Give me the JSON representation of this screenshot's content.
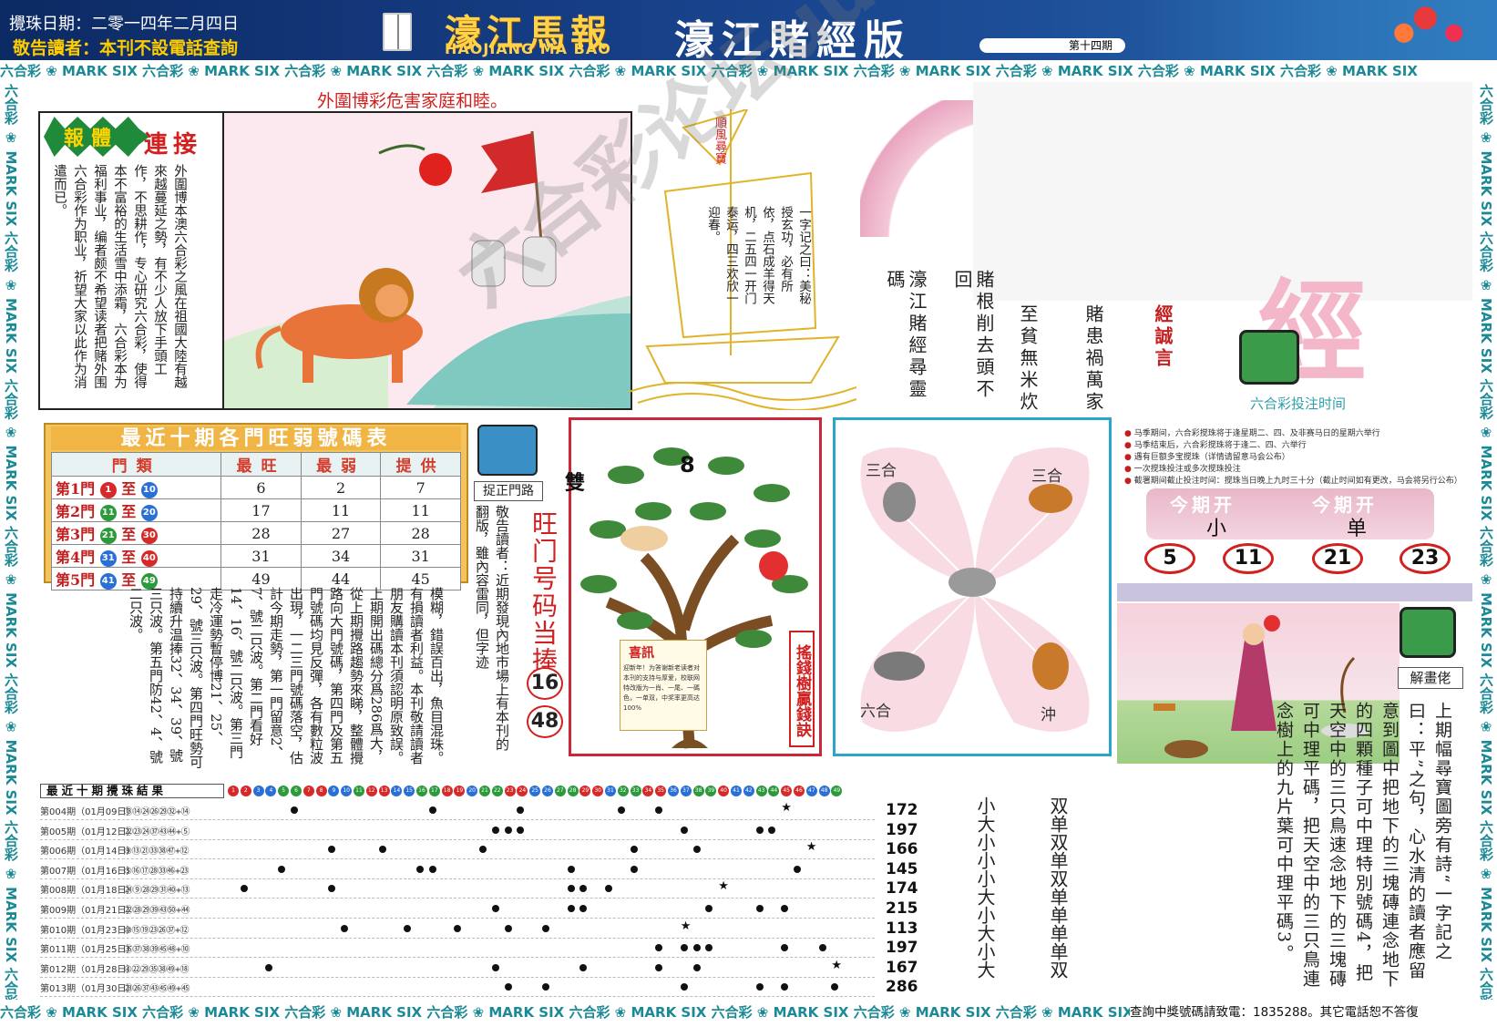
{
  "header": {
    "date": "攪珠日期：二零一四年二月四日",
    "notice": "敬告讀者：本刊不設電話查詢",
    "logo": "濠江馬報",
    "logo_en": "HAOJIANG MA BAO",
    "edition": "濠江賭經版",
    "issue": "第十四期"
  },
  "strip_text": "六合彩 ❀ MARK SIX 六合彩 ❀ MARK SIX 六合彩 ❀ MARK SIX 六合彩 ❀ MARK SIX 六合彩 ❀ MARK SIX 六合彩 ❀ MARK SIX 六合彩 ❀ MARK SIX 六合彩 ❀ MARK SIX 六合彩 ❀ MARK SIX 六合彩 ❀ MARK SIX",
  "warning": {
    "title": "外圍博彩危害家庭和睦。",
    "badge": "報體",
    "badge_link": "連接",
    "text": "外圍博本澳六合彩之風在祖國大陸有越來越蔓延之勢，有不少人放下手頭工作，不思耕作，专心研究六合彩，使得本不富裕的生活雪中添霜，六合彩本为福利事业，编者颇不希望读者把赌外围六合彩作为职业，祈望大家以此作为消遣而已。"
  },
  "boat": {
    "sail": "順風尋寶",
    "text": "一字记之曰：美秘授玄功，必有所依，点石成羊得天机，二五四一开门泰运，四三欢欣一迎春。"
  },
  "sayings": {
    "col1": "濠江賭經尋靈碼",
    "col2": "賭根削去頭不回",
    "col3": "至貧無米炊",
    "col4": "賭患禍萬家",
    "col5": "經誠言"
  },
  "bet_time": {
    "title": "六合彩投注时间",
    "notes": [
      "马季期间，六合彩搅珠将于逢星期二、四、及非赛马日的星期六举行",
      "马季结束后，六合彩搅珠将于逢二、四、六举行",
      "遇有巨额多宝搅珠（详情请留意马会公布）",
      "一次搅珠投注或多次搅珠投注",
      "截署期间截止投注时间：搅珠当日晚上九时三十分（截止时间如有更改，马会将另行公布）"
    ],
    "open_label_1": "今期开",
    "open_label_2": "今期开",
    "open_val_1": "小",
    "open_val_2": "单",
    "numbers": [
      "5",
      "11",
      "21",
      "23"
    ]
  },
  "hot_table": {
    "title": "最近十期各門旺弱號碼表",
    "headers": [
      "門類",
      "最旺",
      "最弱",
      "提供"
    ],
    "rows": [
      {
        "door": "第1門",
        "a": "1",
        "b": "10",
        "hot": "6",
        "weak": "2",
        "give": "7"
      },
      {
        "door": "第2門",
        "a": "11",
        "b": "20",
        "hot": "17",
        "weak": "11",
        "give": "11"
      },
      {
        "door": "第3門",
        "a": "21",
        "b": "30",
        "hot": "28",
        "weak": "27",
        "give": "28"
      },
      {
        "door": "第4門",
        "a": "31",
        "b": "40",
        "hot": "31",
        "weak": "34",
        "give": "31"
      },
      {
        "door": "第5門",
        "a": "41",
        "b": "49",
        "hot": "49",
        "weak": "44",
        "give": "45"
      }
    ],
    "to": "至"
  },
  "door_notice": {
    "label": "捉正門路",
    "hot_door": "旺门号码当捧",
    "nums": [
      "16",
      "48"
    ],
    "col_a": "敬告讀者：近期發現內地市場上有本刊的翻版，雖內容雷同，但字迹",
    "col_b": "模糊，錯誤百出，魚目混珠。有損讀者利益。本刊敬請讀者朋友購讀本刊須認明原致誤。上期開出碼總分爲286爲大，從上期攪路趨勢來睇，整體攪路向大門號碼，第四門及第五門號碼均見反彈，各有數粒波出現，一二三門號碼落空，估計今期走勢，第一門留意2、7、號二只波。第二門看好14、16、號二只波。第三門走冷運勢暫停博21、25、29、號三只波。第四門旺勢可持續升温捧32、34、39、號三只波。第五門防42、4、號二只波。"
  },
  "tree": {
    "num": "8",
    "char": "雙",
    "label": "搖錢樹贏錢訣",
    "xi_title": "喜訊",
    "xi_body": "迎新年！为答谢新老读者对本刊的支持与厚爱，校联网特改版为一肖、一尾、一碼色，一单双，中奖率更高达100%"
  },
  "zodiac": {
    "tl": "三合",
    "tr": "三合",
    "bl": "六合",
    "br": "沖"
  },
  "story": {
    "label": "解畫佬",
    "text": "上期幅尋寶圖旁有詩“一字記之曰：平”之句，心水清的讀者應留意到圖中把地下的三塊磚連念地下的四顆種子可中理特別號碼4，把天空中的三只鳥速念地下的三塊磚可中理平碼，把天空中的三只鳥連念樹上的九片葉可中理平碼3。"
  },
  "results": {
    "title": "最近十期攪珠結果",
    "rows": [
      {
        "issue": "第004期（01月09日）",
        "nums": "⑬⑭㉔㉖㉙㉜+⑭",
        "sum": "172",
        "size": "小",
        "odd": "双"
      },
      {
        "issue": "第005期（01月12日）",
        "nums": "㉒㉓㉔㊲㊸㊹+⑤",
        "sum": "197",
        "size": "大",
        "odd": "单"
      },
      {
        "issue": "第006期（01月14日）",
        "nums": "⑨⑬㉑㉝㊳㊼+⑫",
        "sum": "166",
        "size": "小",
        "odd": "双"
      },
      {
        "issue": "第007期（01月16日）",
        "nums": "⑤⑯⑰㉘㉝㊻+㉓",
        "sum": "145",
        "size": "小",
        "odd": "单"
      },
      {
        "issue": "第008期（01月18日）",
        "nums": "㉔⑨㉘㉙㉛㊵+⑬",
        "sum": "174",
        "size": "小",
        "odd": "双"
      },
      {
        "issue": "第009期（01月21日）",
        "nums": "㉒㉘㉙㊴㊸㊿+㊹",
        "sum": "215",
        "size": "大",
        "odd": "单"
      },
      {
        "issue": "第010期（01月23日）",
        "nums": "⑩⑮⑲㉓㉖㊲+⑫",
        "sum": "113",
        "size": "小",
        "odd": "单"
      },
      {
        "issue": "第011期（01月25日）",
        "nums": "㉟㊲㊳㊴㊺㊽+⑩",
        "sum": "197",
        "size": "大",
        "odd": "单"
      },
      {
        "issue": "第012期（01月28日）",
        "nums": "④㉒㉙㉟㊳㊾+⑱",
        "sum": "167",
        "size": "小",
        "odd": "单"
      },
      {
        "issue": "第013期（01月30日）",
        "nums": "㉓㉖㊲㊸㊺㊾+㊺",
        "sum": "286",
        "size": "大",
        "odd": "双"
      }
    ]
  },
  "footer": {
    "query": "查詢中獎號碼請致電：1835288。其它電話恕不答復"
  },
  "watermark": "六合彩论坛uuu.com",
  "colors": {
    "header_bg": "#163e86",
    "accent_red": "#d21f1f",
    "strip_teal": "#1b8a96",
    "tree_border": "#c8283a",
    "zodiac_border": "#29a6c9"
  }
}
